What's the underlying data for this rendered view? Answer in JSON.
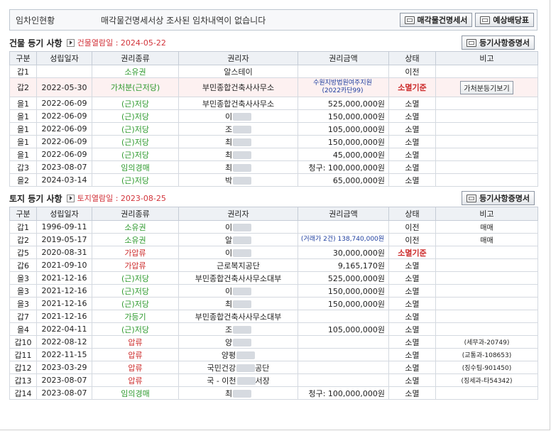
{
  "lease": {
    "label": "임차인현황",
    "message": "매각물건명세서상 조사된 임차내역이 없습니다",
    "btn_sale_spec": "매각물건명세서",
    "btn_distribution": "예상배당표"
  },
  "building": {
    "title": "건물 등기 사항",
    "view_date": "건물열람일 : 2024-05-22",
    "btn_cert": "등기사항증명서",
    "columns": [
      "구분",
      "성립일자",
      "권리종류",
      "권리자",
      "권리금액",
      "상태",
      "비고"
    ],
    "rows": [
      {
        "type": "갑1",
        "date": "",
        "kind": "소유권",
        "holder": "알스테이",
        "amount": "",
        "status": "이전",
        "note": ""
      },
      {
        "type": "갑2",
        "date": "2022-05-30",
        "kind": "가처분(근저당)",
        "holder": "부민종합건축사사무소",
        "amount": "수원지방법원여주지원",
        "amount2": "(2022카단99)",
        "status": "소멸기준",
        "note": "가처분등기보기"
      },
      {
        "type": "을1",
        "date": "2022-06-09",
        "kind": "(근)저당",
        "holder": "부민종합건축사사무소",
        "amount": "525,000,000원",
        "status": "소멸",
        "note": ""
      },
      {
        "type": "을1",
        "date": "2022-06-09",
        "kind": "(근)저당",
        "holder": "이",
        "amount": "150,000,000원",
        "status": "소멸",
        "note": ""
      },
      {
        "type": "을1",
        "date": "2022-06-09",
        "kind": "(근)저당",
        "holder": "조",
        "amount": "105,000,000원",
        "status": "소멸",
        "note": ""
      },
      {
        "type": "을1",
        "date": "2022-06-09",
        "kind": "(근)저당",
        "holder": "최",
        "amount": "150,000,000원",
        "status": "소멸",
        "note": ""
      },
      {
        "type": "을1",
        "date": "2022-06-09",
        "kind": "(근)저당",
        "holder": "최",
        "amount": "45,000,000원",
        "status": "소멸",
        "note": ""
      },
      {
        "type": "갑3",
        "date": "2023-08-07",
        "kind": "임의경매",
        "holder": "최",
        "amount": "청구: 100,000,000원",
        "status": "소멸",
        "note": ""
      },
      {
        "type": "을2",
        "date": "2024-03-14",
        "kind": "(근)저당",
        "holder": "박",
        "amount": "65,000,000원",
        "status": "소멸",
        "note": ""
      }
    ]
  },
  "land": {
    "title": "토지 등기 사항",
    "view_date": "토지열람일 : 2023-08-25",
    "btn_cert": "등기사항증명서",
    "columns": [
      "구분",
      "성립일자",
      "권리종류",
      "권리자",
      "권리금액",
      "상태",
      "비고"
    ],
    "rows": [
      {
        "type": "갑1",
        "date": "1996-09-11",
        "kind": "소유권",
        "holder": "이",
        "amount": "",
        "status": "이전",
        "note": "매매"
      },
      {
        "type": "갑2",
        "date": "2019-05-17",
        "kind": "소유권",
        "holder": "알",
        "amount": "(거래가 2건) 138,740,000원",
        "status": "이전",
        "note": "매매"
      },
      {
        "type": "갑5",
        "date": "2020-08-31",
        "kind": "가압류",
        "holder": "이",
        "amount": "30,000,000원",
        "status": "소멸기준",
        "note": ""
      },
      {
        "type": "갑6",
        "date": "2021-09-10",
        "kind": "가압류",
        "holder": "근로복지공단",
        "amount": "9,165,170원",
        "status": "소멸",
        "note": ""
      },
      {
        "type": "을3",
        "date": "2021-12-16",
        "kind": "(근)저당",
        "holder": "부민종합건축사사무소대부",
        "amount": "525,000,000원",
        "status": "소멸",
        "note": ""
      },
      {
        "type": "을3",
        "date": "2021-12-16",
        "kind": "(근)저당",
        "holder": "이",
        "amount": "150,000,000원",
        "status": "소멸",
        "note": ""
      },
      {
        "type": "을3",
        "date": "2021-12-16",
        "kind": "(근)저당",
        "holder": "최",
        "amount": "150,000,000원",
        "status": "소멸",
        "note": ""
      },
      {
        "type": "갑7",
        "date": "2021-12-16",
        "kind": "가등기",
        "holder": "부민종합건축사사무소대부",
        "amount": "",
        "status": "소멸",
        "note": ""
      },
      {
        "type": "을4",
        "date": "2022-04-11",
        "kind": "(근)저당",
        "holder": "조",
        "amount": "105,000,000원",
        "status": "소멸",
        "note": ""
      },
      {
        "type": "갑10",
        "date": "2022-08-12",
        "kind": "압류",
        "holder": "양",
        "amount": "",
        "status": "소멸",
        "note": "(세무과-20749)"
      },
      {
        "type": "갑11",
        "date": "2022-11-15",
        "kind": "압류",
        "holder": "양평",
        "amount": "",
        "status": "소멸",
        "note": "(교통과-108653)"
      },
      {
        "type": "갑12",
        "date": "2023-03-29",
        "kind": "압류",
        "holder": "국민건강",
        "holder_tail": "공단",
        "amount": "",
        "status": "소멸",
        "note": "(징수팀-901450)"
      },
      {
        "type": "갑13",
        "date": "2023-08-07",
        "kind": "압류",
        "holder": "국 - 이천",
        "holder_tail": "서장",
        "amount": "",
        "status": "소멸",
        "note": "(징세과-타54342)"
      },
      {
        "type": "갑14",
        "date": "2023-08-07",
        "kind": "임의경매",
        "holder": "최",
        "amount": "청구: 100,000,000원",
        "status": "소멸",
        "note": ""
      }
    ]
  },
  "colors": {
    "accent_red": "#cc2a2a",
    "kind_green": "#2e9a2e",
    "amount_blue": "#2040a0"
  }
}
